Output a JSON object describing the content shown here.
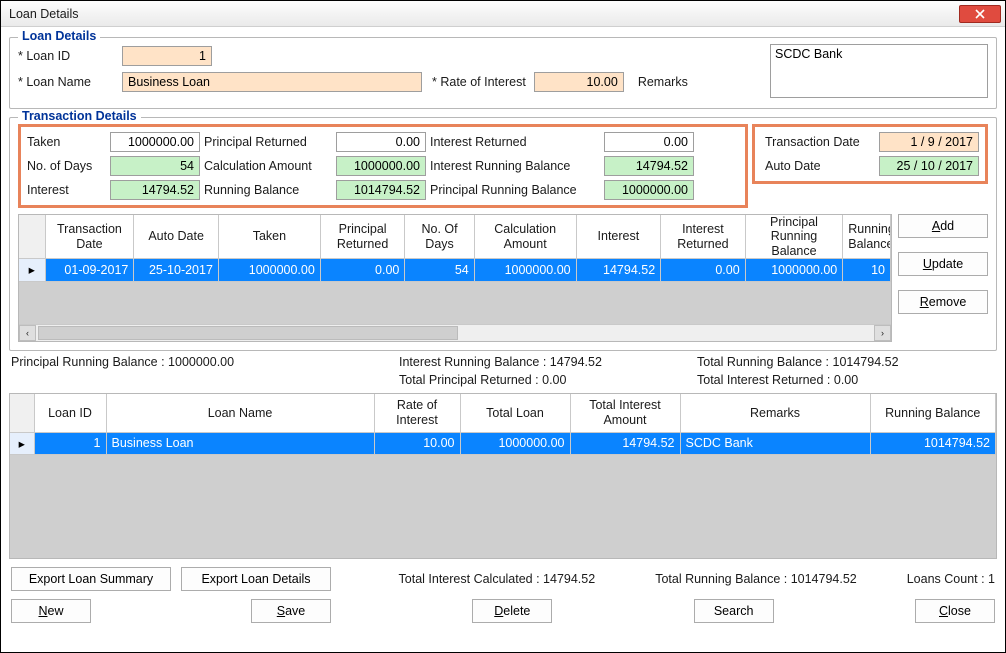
{
  "window": {
    "title": "Loan Details"
  },
  "loanDetails": {
    "legend": "Loan Details",
    "loan_id_label": "* Loan ID",
    "loan_id_value": "1",
    "loan_name_label": "* Loan Name",
    "loan_name_value": "Business Loan",
    "rate_label": "* Rate of Interest",
    "rate_value": "10.00",
    "remarks_label": "Remarks",
    "remarks_value": "SCDC Bank"
  },
  "txDetails": {
    "legend": "Transaction Details",
    "labels": {
      "taken": "Taken",
      "principal_returned": "Principal Returned",
      "interest_returned": "Interest Returned",
      "no_of_days": "No. of Days",
      "calculation_amount": "Calculation Amount",
      "interest_running_balance": "Interest Running Balance",
      "interest": "Interest",
      "running_balance": "Running Balance",
      "principal_running_balance": "Principal Running Balance",
      "transaction_date": "Transaction Date",
      "auto_date": "Auto Date"
    },
    "values": {
      "taken": "1000000.00",
      "principal_returned": "0.00",
      "interest_returned": "0.00",
      "no_of_days": "54",
      "calculation_amount": "1000000.00",
      "interest_running_balance": "14794.52",
      "interest": "14794.52",
      "running_balance": "1014794.52",
      "principal_running_balance": "1000000.00",
      "transaction_date": "1 / 9 / 2017",
      "auto_date": "25 / 10 / 2017"
    }
  },
  "txGrid": {
    "headers": {
      "transaction_date": "Transaction Date",
      "auto_date": "Auto Date",
      "taken": "Taken",
      "principal_returned": "Principal Returned",
      "no_of_days": "No. Of Days",
      "calculation_amount": "Calculation Amount",
      "interest": "Interest",
      "interest_returned": "Interest Returned",
      "principal_running_balance": "Principal Running Balance",
      "running_balance": "Running Balance"
    },
    "row": {
      "transaction_date": "01-09-2017",
      "auto_date": "25-10-2017",
      "taken": "1000000.00",
      "principal_returned": "0.00",
      "no_of_days": "54",
      "calculation_amount": "1000000.00",
      "interest": "14794.52",
      "interest_returned": "0.00",
      "principal_running_balance": "1000000.00",
      "running_balance": "10"
    }
  },
  "buttons": {
    "add": "Add",
    "add_mn": "A",
    "update": "Update",
    "update_mn": "U",
    "remove": "Remove",
    "remove_mn": "R",
    "export_summary": "Export Loan Summary",
    "export_details": "Export Loan Details",
    "new": "New",
    "new_mn": "N",
    "save": "Save",
    "save_mn": "S",
    "delete": "Delete",
    "delete_mn": "D",
    "search": "Search",
    "close": "Close",
    "close_mn": "C"
  },
  "status": {
    "principal_running_balance": "Principal Running Balance : 1000000.00",
    "interest_running_balance": "Interest Running Balance : 14794.52",
    "total_running_balance": "Total Running Balance : 1014794.52",
    "total_principal_returned": "Total Principal Returned : 0.00",
    "total_interest_returned": "Total Interest Returned : 0.00"
  },
  "sumGrid": {
    "headers": {
      "loan_id": "Loan ID",
      "loan_name": "Loan Name",
      "rate": "Rate of Interest",
      "total_loan": "Total Loan",
      "total_interest": "Total Interest Amount",
      "remarks": "Remarks",
      "running_balance": "Running Balance"
    },
    "row": {
      "loan_id": "1",
      "loan_name": "Business Loan",
      "rate": "10.00",
      "total_loan": "1000000.00",
      "total_interest": "14794.52",
      "remarks": "SCDC Bank",
      "running_balance": "1014794.52"
    }
  },
  "footer": {
    "total_interest_calculated": "Total Interest Calculated : 14794.52",
    "total_running_balance": "Total Running Balance : 1014794.52",
    "loans_count": "Loans Count : 1"
  },
  "glyphs": {
    "row_indicator": "▸",
    "left_arrow": "‹",
    "right_arrow": "›"
  }
}
